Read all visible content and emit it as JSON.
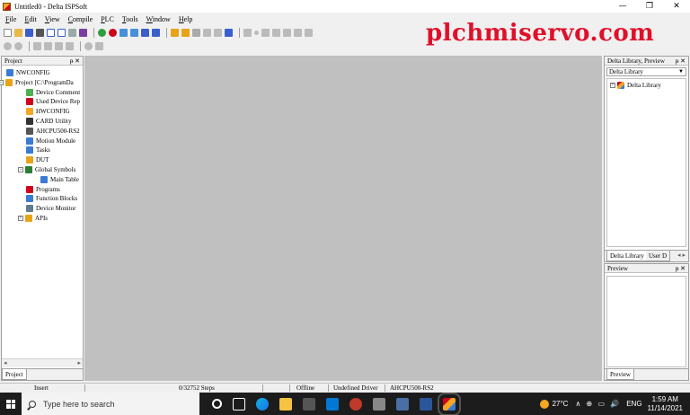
{
  "window": {
    "title": "Untitled0 - Delta ISPSoft",
    "controls": [
      "—",
      "❐",
      "✕"
    ]
  },
  "menu": [
    "File",
    "Edit",
    "View",
    "Compile",
    "PLC",
    "Tools",
    "Window",
    "Help"
  ],
  "watermark": "plchmiservo.com",
  "project_panel": {
    "title": "Project",
    "pin": "ᵽ ✕",
    "tree": [
      {
        "label": "NWCONFIG",
        "level": 0,
        "color": "#3a7bd5"
      },
      {
        "label": "Project [C:\\ProgramDa",
        "level": 0,
        "color": "#e8a317",
        "expander": "-"
      },
      {
        "label": "Device Comment",
        "level": 1,
        "color": "#4caf50"
      },
      {
        "label": "Used Device Rep",
        "level": 1,
        "color": "#d0021b"
      },
      {
        "label": "HWCONFIG",
        "level": 1,
        "color": "#f5a623"
      },
      {
        "label": "CARD Utility",
        "level": 1,
        "color": "#333333"
      },
      {
        "label": "AHCPU500-RS2",
        "level": 1,
        "color": "#555555"
      },
      {
        "label": "Motion Module",
        "level": 1,
        "color": "#3a7bd5"
      },
      {
        "label": "Tasks",
        "level": 1,
        "color": "#3a7bd5"
      },
      {
        "label": "DUT",
        "level": 1,
        "color": "#e8a317"
      },
      {
        "label": "Global Symbols",
        "level": 1,
        "color": "#2e7d32",
        "expander": "-"
      },
      {
        "label": "Main Table",
        "level": 2,
        "color": "#3a7bd5"
      },
      {
        "label": "Programs",
        "level": 1,
        "color": "#d0021b"
      },
      {
        "label": "Function Blocks",
        "level": 1,
        "color": "#3a7bd5"
      },
      {
        "label": "Device Monitor",
        "level": 1,
        "color": "#607d8b"
      },
      {
        "label": "APIs",
        "level": 1,
        "color": "#e8a317",
        "expander": "+"
      }
    ],
    "tab": "Project"
  },
  "library_panel": {
    "title": "Delta Library, Preview",
    "pin": "ᵽ ✕",
    "combo": "Delta Library",
    "tree_item": "Delta Library",
    "tabs": [
      "Delta Library",
      "User D"
    ],
    "tab_arrows": "◂ ▸"
  },
  "preview_panel": {
    "title": "Preview",
    "pin": "ᵽ ✕",
    "tab": "Preview"
  },
  "status": {
    "mode": "Insert",
    "steps": "0/32752 Steps",
    "state": "Offline",
    "driver": "Undefined Driver",
    "cpu": "AHCPU500-RS2"
  },
  "taskbar": {
    "search_placeholder": "Type here to search",
    "temp": "27°C",
    "tray_icons": "∧ ⊕ ▭ 🔊",
    "lang": "ENG",
    "time": "1:59 AM",
    "date": "11/14/2021"
  },
  "colors": {
    "workspace": "#c0c0c0",
    "watermark": "#e0102a",
    "taskbar": "#1c1c1c"
  }
}
